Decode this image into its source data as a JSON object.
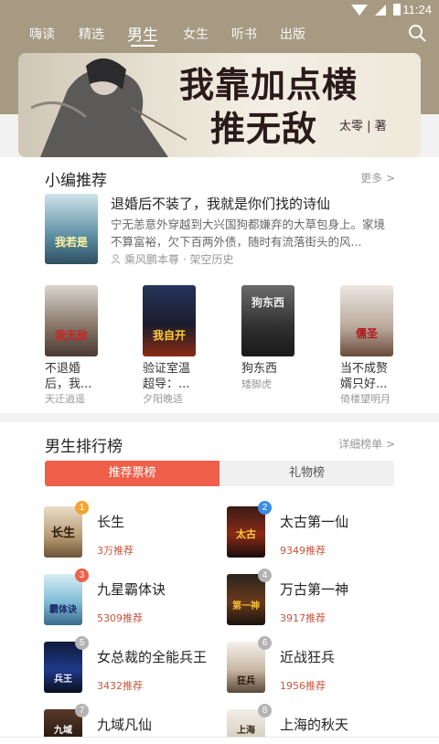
{
  "status": {
    "time": "11:24"
  },
  "nav": {
    "tabs": [
      {
        "label": "嗨读"
      },
      {
        "label": "精选"
      },
      {
        "label": "男生"
      },
      {
        "label": "女生"
      },
      {
        "label": "听书"
      },
      {
        "label": "出版"
      }
    ],
    "active_tab": "男生"
  },
  "banner": {
    "title_line1": "我靠加点横",
    "title_line2": "推无敌",
    "author": "太零 | 著"
  },
  "editor_picks": {
    "title": "小编推荐",
    "more_label": "更多 >",
    "featured": {
      "cover_text": "我若是",
      "title": "退婚后不装了，我就是你们找的诗仙",
      "description": "宁无恙意外穿越到大兴国狗都嫌弃的大草包身上。家境不算富裕，欠下百两外债，随时有流落街头的风...",
      "meta": "乘风鹏本尊 · 架空历史"
    },
    "books": [
      {
        "title": "不退婚后，我...",
        "author": "天迁逍遥",
        "cover_text": "我无敌"
      },
      {
        "title": "验证室温超导：...",
        "author": "夕阳晚适",
        "cover_text": "我自开"
      },
      {
        "title": "狗东西",
        "author": "矮脚虎",
        "cover_text": "狗东西"
      },
      {
        "title": "当不成赘婿只好...",
        "author": "倚楼望明月",
        "cover_text": "儒圣"
      }
    ]
  },
  "ranking": {
    "title": "男生排行榜",
    "more_label": "详细榜单 >",
    "tabs": [
      {
        "label": "推荐票榜"
      },
      {
        "label": "礼物榜"
      }
    ],
    "items": [
      {
        "rank": "1",
        "name": "长生",
        "votes": "3万推荐",
        "cover_text": "长生"
      },
      {
        "rank": "2",
        "name": "太古第一仙",
        "votes": "9349推荐",
        "cover_text": "太古"
      },
      {
        "rank": "3",
        "name": "九星霸体诀",
        "votes": "5309推荐",
        "cover_text": "霸体诀"
      },
      {
        "rank": "4",
        "name": "万古第一神",
        "votes": "3917推荐",
        "cover_text": "第一神"
      },
      {
        "rank": "5",
        "name": "女总裁的全能兵王",
        "votes": "3432推荐",
        "cover_text": "兵王"
      },
      {
        "rank": "6",
        "name": "近战狂兵",
        "votes": "1956推荐",
        "cover_text": "狂兵"
      },
      {
        "rank": "7",
        "name": "九域凡仙",
        "votes": "",
        "cover_text": "九域"
      },
      {
        "rank": "8",
        "name": "上海的秋天",
        "votes": "",
        "cover_text": "上海"
      }
    ]
  },
  "colors": {
    "header": "#a79a83",
    "accent": "#ef5f4a",
    "vote_text": "#c6563f",
    "badge_gold": "#f3a533",
    "badge_blue": "#3c8de6",
    "badge_red": "#ef5f4a",
    "badge_gray": "#b3b3b3"
  },
  "icons": [
    "wifi-icon",
    "signal-icon",
    "battery-icon",
    "search-icon",
    "person-icon"
  ]
}
